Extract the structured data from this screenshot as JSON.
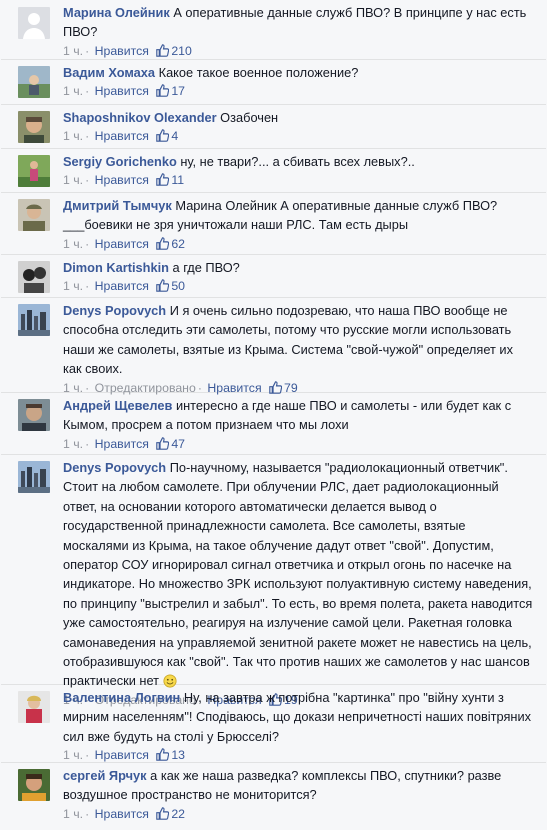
{
  "comments": [
    {
      "author": "Марина Олейник",
      "text": "А оперативные данные служб ПВО? В принципе у нас есть ПВО?",
      "time": "1 ч.",
      "edited": "",
      "like_label": "Нравится",
      "likes": "210"
    },
    {
      "author": "Вадим Хомаха",
      "text": "Какое такое военное положение?",
      "time": "1 ч.",
      "edited": "",
      "like_label": "Нравится",
      "likes": "17"
    },
    {
      "author": "Shaposhnikov Olexander",
      "text": "Озабочен",
      "time": "1 ч.",
      "edited": "",
      "like_label": "Нравится",
      "likes": "4"
    },
    {
      "author": "Sergiy Gorichenko",
      "text": "ну, не твари?... а сбивать всех левых?..",
      "time": "1 ч.",
      "edited": "",
      "like_label": "Нравится",
      "likes": "11"
    },
    {
      "author": "Дмитрий Тымчук",
      "text": "Марина Олейник А оперативные данные служб ПВО? ___боевики не зря уничтожали наши РЛС. Там есть дыры",
      "time": "1 ч.",
      "edited": "",
      "like_label": "Нравится",
      "likes": "62"
    },
    {
      "author": "Dimon Kartishkin",
      "text": "а где ПВО?",
      "time": "1 ч.",
      "edited": "",
      "like_label": "Нравится",
      "likes": "50"
    },
    {
      "author": "Denys Popovych",
      "text": "И я очень сильно подозреваю, что наша ПВО вообще не способна отследить эти самолеты, потому что русские могли использовать наши же самолеты, взятые из Крыма. Система \"свой-чужой\" определяет их как своих.",
      "time": "1 ч.",
      "edited": "Отредактировано",
      "like_label": "Нравится",
      "likes": "79"
    },
    {
      "author": "Андрей Щевелев",
      "text": "интересно а где наше ПВО и самолеты - или будет как с Кымом, просрем а потом признаем что мы лохи",
      "time": "1 ч.",
      "edited": "",
      "like_label": "Нравится",
      "likes": "47"
    },
    {
      "author": "Denys Popovych",
      "text": "По-научному, называется \"радиолокационный ответчик\". Стоит на любом самолете. При облучении РЛС, дает радиолокационный ответ, на основании которого автоматически делается вывод о государственной принадлежности самолета. Все самолеты, взятые москалями из Крыма, на такое облучение дадут ответ \"свой\". Допустим, оператор СОУ игнорировал сигнал ответчика и открыл огонь по насечке на индикаторе. Но множество ЗРК используют полуактивную систему наведения, по принципу \"выстрелил и забыл\". То есть, во время полета, ракета наводится уже самостоятельно, реагируя на излучение самой цели. Ракетная головка самонаведения на управляемой зенитной ракете может не навестись на цель, отобразившуюся как \"свой\". Так что против наших же самолетов у нас шансов практически нет",
      "time": "1 ч.",
      "edited": "Отредактировано",
      "like_label": "Нравится",
      "likes": "19"
    },
    {
      "author": "Валентина Логвин",
      "text": "Ну, на завтра ж потрібна \"картинка\" про \"війну хунти з мирним населенням\"! Сподіваюсь, що докази непричетності наших повітряних сил вже будуть на столі у Брюсселі?",
      "time": "1 ч.",
      "edited": "",
      "like_label": "Нравится",
      "likes": "13"
    },
    {
      "author": "сергей Ярчук",
      "text": "а как же наша разведка? комплексы ПВО, спутники? разве воздушное пространство не мониторится?",
      "time": "1 ч.",
      "edited": "",
      "like_label": "Нравится",
      "likes": "22"
    }
  ],
  "colors": {
    "link": "#3b5998",
    "meta": "#90949c",
    "text": "#141823",
    "background": "#f6f7f9"
  },
  "icons": {
    "like": "thumbs-up-icon",
    "emoji": "smiley-icon"
  }
}
